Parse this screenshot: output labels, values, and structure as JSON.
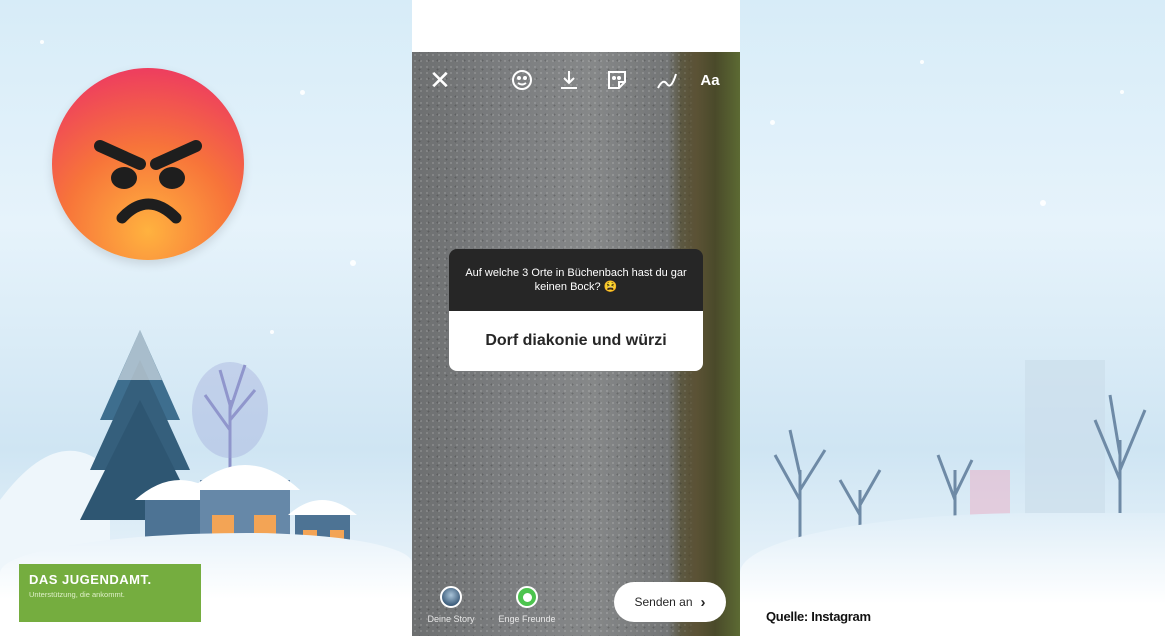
{
  "logo": {
    "title": "DAS JUGENDAMT.",
    "subtitle": "Unterstützung, die ankommt."
  },
  "emoji": {
    "icon": "angry-face-icon"
  },
  "story_editor": {
    "toolbar": {
      "close_icon": "close-icon",
      "face_filter_icon": "face-filter-icon",
      "download_icon": "download-icon",
      "sticker_icon": "sticker-icon",
      "draw_icon": "draw-icon",
      "text_label": "Aa"
    },
    "question_sticker": {
      "question": "Auf welche 3 Orte in Büchenbach hast du gar keinen Bock? 😫",
      "answer": "Dorf diakonie und würzi"
    },
    "bottom": {
      "your_story_label": "Deine Story",
      "close_friends_label": "Enge Freunde",
      "send_label": "Senden an",
      "send_icon": "chevron-right-icon"
    }
  },
  "source_caption": "Quelle: Instagram",
  "colors": {
    "logo_green": "#75ad3f",
    "question_bg": "#262626",
    "close_friends_green": "#4cc44e"
  }
}
